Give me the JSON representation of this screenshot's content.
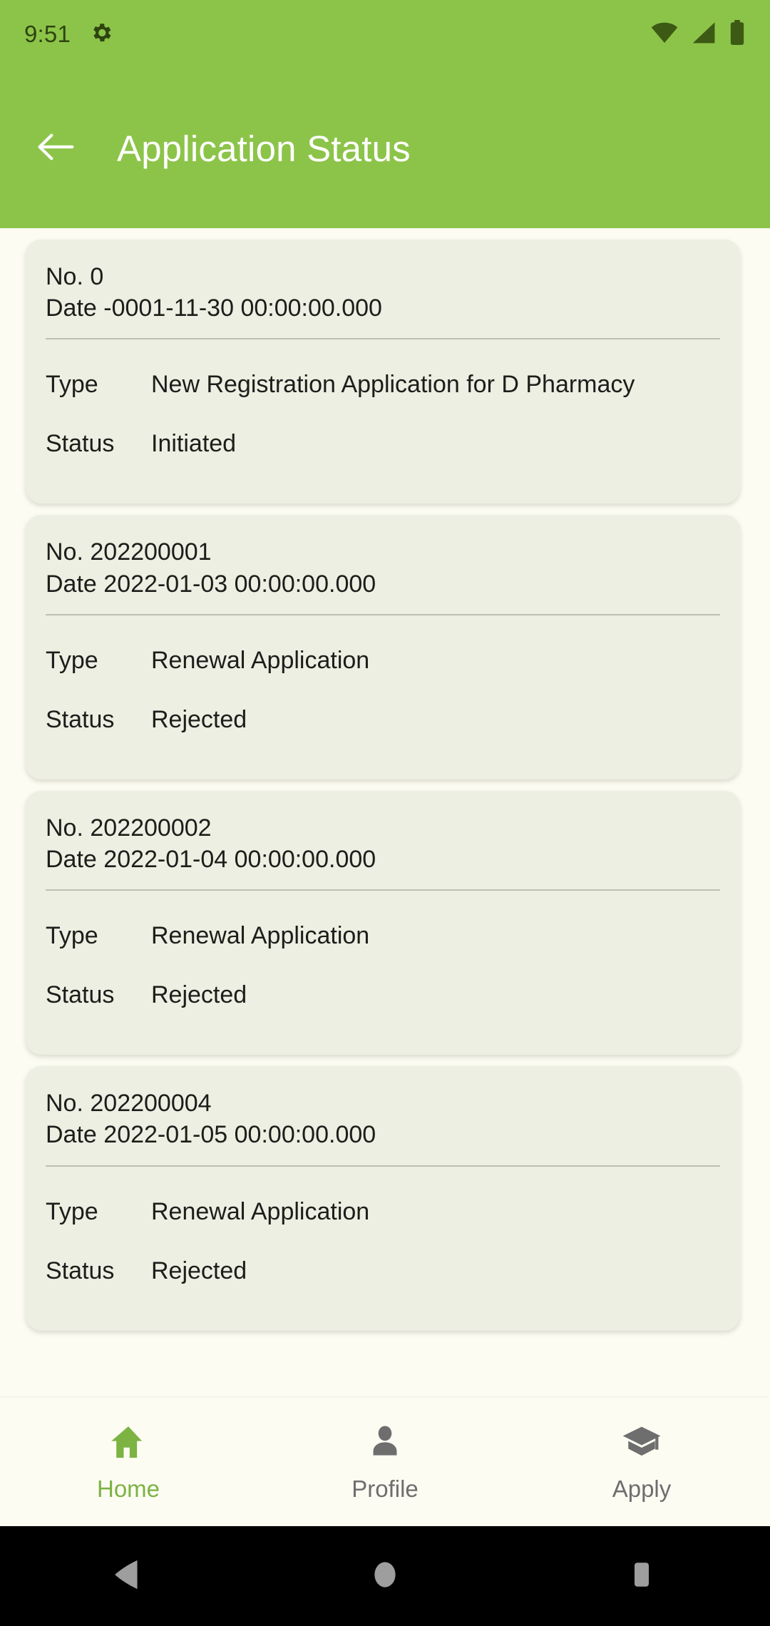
{
  "status_bar": {
    "clock": "9:51",
    "icons": [
      "gear-icon",
      "wifi-icon",
      "cellular-signal-icon",
      "battery-icon"
    ]
  },
  "app_bar": {
    "back_icon": "arrow-left-icon",
    "title": "Application Status"
  },
  "colors": {
    "header_green": "#8CC449",
    "accent_green": "#7CB342",
    "card_bg": "#ECEFE1",
    "page_bg": "#FDFCF3",
    "text": "#1D1D1B",
    "muted": "#6E6E6E"
  },
  "labels": {
    "no": "No.",
    "date": "Date",
    "type": "Type",
    "status": "Status"
  },
  "applications": [
    {
      "no": "0",
      "date": "-0001-11-30 00:00:00.000",
      "type": "New Registration Application for D Pharmacy",
      "status": "Initiated"
    },
    {
      "no": "202200001",
      "date": "2022-01-03 00:00:00.000",
      "type": "Renewal Application",
      "status": "Rejected"
    },
    {
      "no": "202200002",
      "date": "2022-01-04 00:00:00.000",
      "type": "Renewal Application",
      "status": "Rejected"
    },
    {
      "no": "202200004",
      "date": "2022-01-05 00:00:00.000",
      "type": "Renewal Application",
      "status": "Rejected"
    }
  ],
  "bottom_nav": {
    "items": [
      {
        "label": "Home",
        "icon": "home-icon",
        "active": true
      },
      {
        "label": "Profile",
        "icon": "person-icon",
        "active": false
      },
      {
        "label": "Apply",
        "icon": "graduation-cap-icon",
        "active": false
      }
    ]
  },
  "android_nav": {
    "back": "triangle-back-icon",
    "home": "circle-home-icon",
    "recents": "square-recents-icon"
  }
}
